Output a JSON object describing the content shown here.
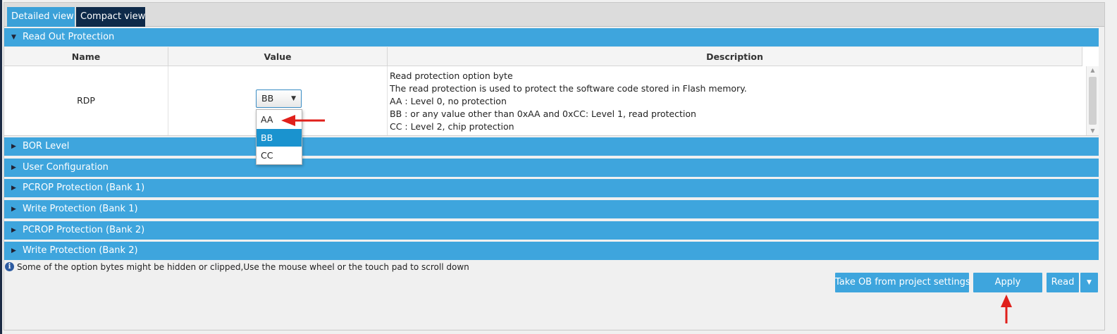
{
  "tabs": {
    "detailed": "Detailed view",
    "compact": "Compact view"
  },
  "sections": {
    "read_out_protection": "Read Out Protection",
    "bor_level": "BOR Level",
    "user_configuration": "User Configuration",
    "pcrop_bank1": "PCROP Protection (Bank 1)",
    "write_bank1": "Write Protection (Bank 1)",
    "pcrop_bank2": "PCROP Protection (Bank 2)",
    "write_bank2": "Write Protection (Bank 2)"
  },
  "table": {
    "headers": {
      "name": "Name",
      "value": "Value",
      "description": "Description"
    },
    "row": {
      "name": "RDP",
      "value": "BB",
      "description": [
        "Read protection option byte",
        "The read protection is used to protect the software code stored in Flash memory.",
        "AA : Level 0, no protection",
        "BB : or any value other than 0xAA and 0xCC: Level 1, read protection",
        "CC : Level 2, chip protection"
      ]
    },
    "options": [
      "AA",
      "BB",
      "CC"
    ],
    "selected_option": "BB"
  },
  "info": {
    "icon": "info-icon",
    "message": "Some of the option bytes might be hidden or clipped,Use the mouse wheel or the touch pad to scroll down"
  },
  "buttons": {
    "take_ob": "Take OB from project settings",
    "apply": "Apply",
    "read": "Read"
  },
  "colors": {
    "section_blue": "#3ea5dd",
    "tab_active": "#0e2a4a",
    "selection": "#1a93cf",
    "annotation_red": "#e0201b"
  }
}
